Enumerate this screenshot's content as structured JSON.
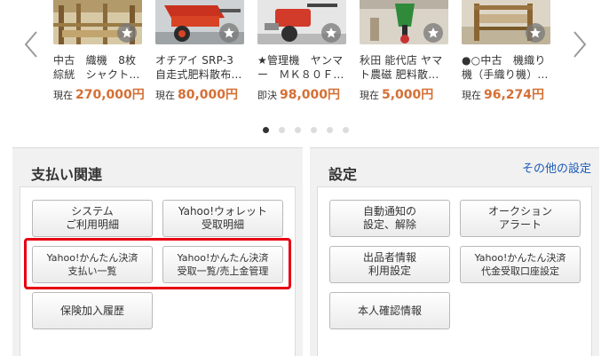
{
  "carousel": {
    "items": [
      {
        "title": "中古　織機　8枚綜絖　シャクト…",
        "price_label": "現在",
        "price": "270,000円",
        "image": "loom-photo"
      },
      {
        "title": "オチアイ SRP-3 自走式肥料散布…",
        "price_label": "現在",
        "price": "80,000円",
        "image": "red-spreader-photo"
      },
      {
        "title": "★管理機　ヤンマー　ＭＫ８０Ｆ…",
        "price_label": "即決",
        "price": "98,000円",
        "image": "cultivator-photo"
      },
      {
        "title": "秋田 能代店 ヤマト農磁 肥料散…",
        "price_label": "現在",
        "price": "5,000円",
        "image": "green-spreader-photo"
      },
      {
        "title": "●○中古　機織り機（手織り機）…",
        "price_label": "現在",
        "price": "96,274円",
        "image": "weaving-machine-photo"
      }
    ],
    "page_count": 6,
    "active_page": 1,
    "prev_icon": "chevron-left-icon",
    "next_icon": "chevron-right-icon",
    "favorite_icon": "star-icon"
  },
  "payment": {
    "title": "支払い関連",
    "buttons": [
      {
        "line1": "システム",
        "line2": "ご利用明細"
      },
      {
        "line1": "Yahoo!ウォレット",
        "line2": "受取明細"
      },
      {
        "line1": "Yahoo!かんたん決済",
        "line2": "支払い一覧"
      },
      {
        "line1": "Yahoo!かんたん決済",
        "line2": "受取一覧/売上金管理"
      },
      {
        "line1": "保険加入履歴",
        "line2": ""
      }
    ]
  },
  "settings": {
    "title": "設定",
    "more_link": "その他の設定",
    "buttons": [
      {
        "line1": "自動通知の",
        "line2": "設定、解除"
      },
      {
        "line1": "オークション",
        "line2": "アラート"
      },
      {
        "line1": "出品者情報",
        "line2": "利用設定"
      },
      {
        "line1": "Yahoo!かんたん決済",
        "line2": "代金受取口座設定"
      },
      {
        "line1": "本人確認情報",
        "line2": ""
      }
    ]
  },
  "colors": {
    "price": "#d56f35",
    "link": "#1a5ab8",
    "highlight": "#e60012",
    "panel_bg": "#f1f1f1"
  }
}
